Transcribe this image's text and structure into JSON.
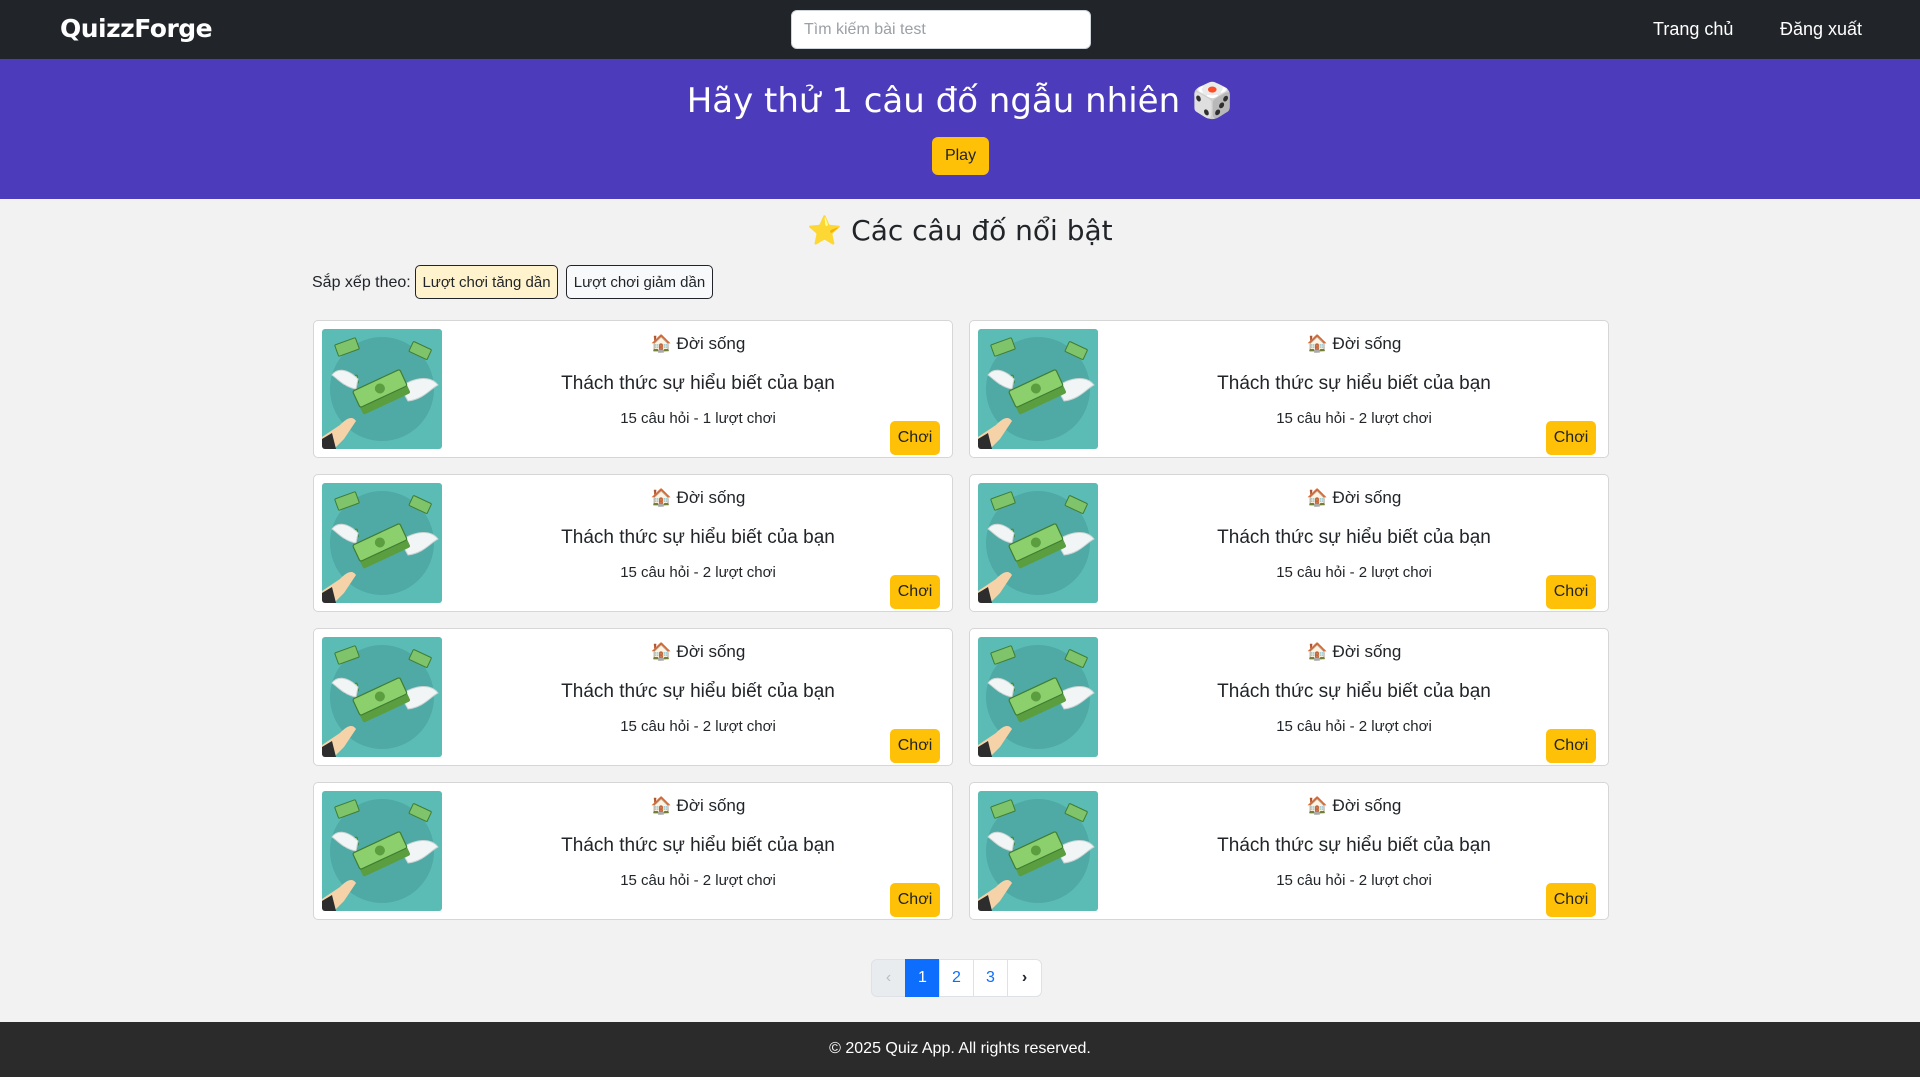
{
  "navbar": {
    "brand": "QuizzForge",
    "search_placeholder": "Tìm kiếm bài test",
    "home": "Trang chủ",
    "logout": "Đăng xuất"
  },
  "hero": {
    "title": "Hãy thử 1 câu đố ngẫu nhiên 🎲",
    "play": "Play",
    "bg_color": "#4c3bbb"
  },
  "section": {
    "title": "⭐ Các câu đố nổi bật",
    "sort_label": "Sắp xếp theo:",
    "sort_asc": "Lượt chơi tăng dần",
    "sort_desc": "Lượt chơi giảm dần"
  },
  "quizzes": [
    {
      "category": "🏠 Đời sống",
      "title": "Thách thức sự hiểu biết của bạn",
      "meta": "15 câu hỏi - 1 lượt chơi",
      "button": "Chơi",
      "image": "flying-money-icon"
    },
    {
      "category": "🏠 Đời sống",
      "title": "Thách thức sự hiểu biết của bạn",
      "meta": "15 câu hỏi - 2 lượt chơi",
      "button": "Chơi",
      "image": "flying-money-icon"
    },
    {
      "category": "🏠 Đời sống",
      "title": "Thách thức sự hiểu biết của bạn",
      "meta": "15 câu hỏi - 2 lượt chơi",
      "button": "Chơi",
      "image": "flying-money-icon"
    },
    {
      "category": "🏠 Đời sống",
      "title": "Thách thức sự hiểu biết của bạn",
      "meta": "15 câu hỏi - 2 lượt chơi",
      "button": "Chơi",
      "image": "flying-money-icon"
    },
    {
      "category": "🏠 Đời sống",
      "title": "Thách thức sự hiểu biết của bạn",
      "meta": "15 câu hỏi - 2 lượt chơi",
      "button": "Chơi",
      "image": "flying-money-icon"
    },
    {
      "category": "🏠 Đời sống",
      "title": "Thách thức sự hiểu biết của bạn",
      "meta": "15 câu hỏi - 2 lượt chơi",
      "button": "Chơi",
      "image": "flying-money-icon"
    },
    {
      "category": "🏠 Đời sống",
      "title": "Thách thức sự hiểu biết của bạn",
      "meta": "15 câu hỏi - 2 lượt chơi",
      "button": "Chơi",
      "image": "flying-money-icon"
    },
    {
      "category": "🏠 Đời sống",
      "title": "Thách thức sự hiểu biết của bạn",
      "meta": "15 câu hỏi - 2 lượt chơi",
      "button": "Chơi",
      "image": "flying-money-icon"
    }
  ],
  "pagination": {
    "prev": "‹",
    "pages": [
      "1",
      "2",
      "3"
    ],
    "active": "1",
    "next": "›"
  },
  "footer": {
    "text": "© 2025 Quiz App. All rights reserved."
  }
}
